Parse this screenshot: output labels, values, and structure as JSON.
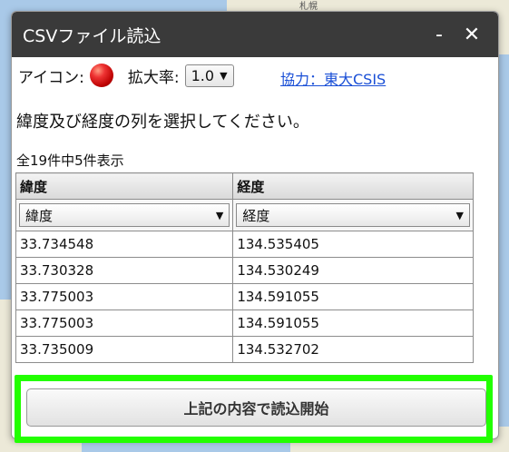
{
  "map": {
    "label_top": "札幌"
  },
  "dialog": {
    "title": "CSVファイル読込",
    "minimize_label": "-",
    "close_label": "✕",
    "icon_label": "アイコン:",
    "zoom_label": "拡大率:",
    "zoom_value": "1.0",
    "credit_link": "協力：東大CSIS",
    "instruction": "緯度及び経度の列を選択してください。",
    "record_count": "全19件中5件表示",
    "table": {
      "headers": [
        "緯度",
        "経度"
      ],
      "selects": [
        "緯度",
        "経度"
      ],
      "rows": [
        [
          "33.734548",
          "134.535405"
        ],
        [
          "33.730328",
          "134.530249"
        ],
        [
          "33.775003",
          "134.591055"
        ],
        [
          "33.775003",
          "134.591055"
        ],
        [
          "33.735009",
          "134.532702"
        ]
      ]
    },
    "start_button": "上記の内容で読込開始"
  },
  "colors": {
    "highlight": "#22ff00",
    "titlebar": "#3a3a3a",
    "link": "#1a4fd6"
  }
}
